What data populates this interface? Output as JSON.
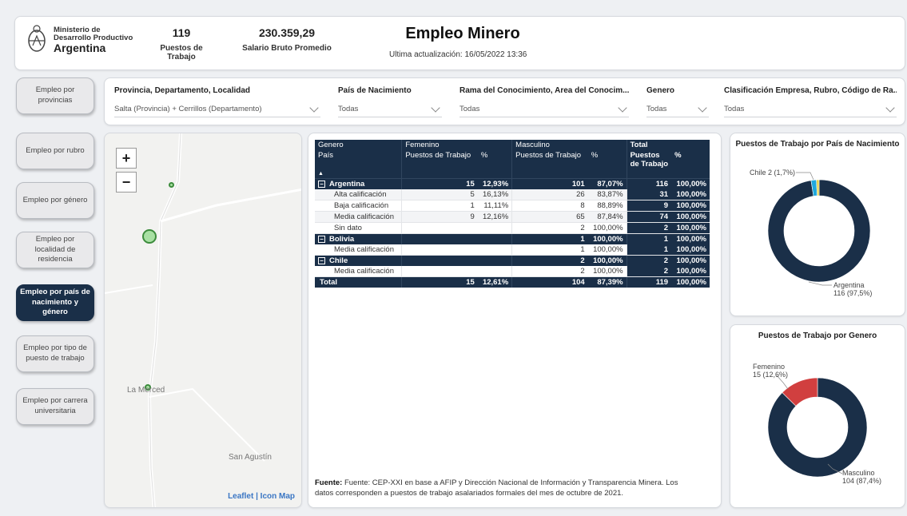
{
  "header": {
    "logo_line1": "Ministerio de",
    "logo_line2": "Desarrollo Productivo",
    "logo_line3": "Argentina",
    "kpi_jobs_value": "119",
    "kpi_jobs_label": "Puestos de Trabajo",
    "kpi_salary_value": "230.359,29",
    "kpi_salary_label": "Salario Bruto Promedio",
    "title": "Empleo Minero",
    "updated": "Ultima actualización: 16/05/2022 13:36"
  },
  "nav": [
    {
      "label": "Empleo por provincias",
      "active": false
    },
    {
      "label": "Empleo por rubro",
      "active": false
    },
    {
      "label": "Empleo por género",
      "active": false
    },
    {
      "label": "Empleo por localidad de residencia",
      "active": false
    },
    {
      "label": "Empleo por país de nacimiento y género",
      "active": true
    },
    {
      "label": "Empleo por tipo de puesto de trabajo",
      "active": false
    },
    {
      "label": "Empleo por carrera universitaria",
      "active": false
    }
  ],
  "filters": [
    {
      "label": "Provincia, Departamento, Localidad",
      "value": "Salta (Provincia) + Cerrillos (Departamento)"
    },
    {
      "label": "País de Nacimiento",
      "value": "Todas"
    },
    {
      "label": "Rama del Conocimiento, Area del Conocim...",
      "value": "Todas"
    },
    {
      "label": "Genero",
      "value": "Todas"
    },
    {
      "label": "Clasificación Empresa, Rubro, Código de Ra...",
      "value": "Todas"
    }
  ],
  "map": {
    "zoom_in": "+",
    "zoom_out": "−",
    "place1": "La Merced",
    "place2": "San Agustín",
    "attribution": "Leaflet | Icon Map"
  },
  "table": {
    "h_genero": "Genero",
    "h_femenino": "Femenino",
    "h_masculino": "Masculino",
    "h_total": "Total",
    "h_pais": "País",
    "h_puestos": "Puestos de Trabajo",
    "h_pct": "%",
    "h_total_puestos": "Puestos de Trabajo",
    "sort_marker": "▲",
    "expander": "−",
    "rows": [
      {
        "type": "grp",
        "name": "Argentina",
        "f_n": "15",
        "f_p": "12,93%",
        "m_n": "101",
        "m_p": "87,07%",
        "t_n": "116",
        "t_p": "100,00%"
      },
      {
        "type": "sub",
        "name": "Alta calificación",
        "f_n": "5",
        "f_p": "16,13%",
        "m_n": "26",
        "m_p": "83,87%",
        "t_n": "31",
        "t_p": "100,00%"
      },
      {
        "type": "sub",
        "name": "Baja calificación",
        "f_n": "1",
        "f_p": "11,11%",
        "m_n": "8",
        "m_p": "88,89%",
        "t_n": "9",
        "t_p": "100,00%"
      },
      {
        "type": "sub",
        "name": "Media calificación",
        "f_n": "9",
        "f_p": "12,16%",
        "m_n": "65",
        "m_p": "87,84%",
        "t_n": "74",
        "t_p": "100,00%"
      },
      {
        "type": "sub",
        "name": "Sin dato",
        "f_n": "",
        "f_p": "",
        "m_n": "2",
        "m_p": "100,00%",
        "t_n": "2",
        "t_p": "100,00%"
      },
      {
        "type": "grp",
        "name": "Bolivia",
        "f_n": "",
        "f_p": "",
        "m_n": "1",
        "m_p": "100,00%",
        "t_n": "1",
        "t_p": "100,00%"
      },
      {
        "type": "sub",
        "name": "Media calificación",
        "f_n": "",
        "f_p": "",
        "m_n": "1",
        "m_p": "100,00%",
        "t_n": "1",
        "t_p": "100,00%"
      },
      {
        "type": "grp",
        "name": "Chile",
        "f_n": "",
        "f_p": "",
        "m_n": "2",
        "m_p": "100,00%",
        "t_n": "2",
        "t_p": "100,00%"
      },
      {
        "type": "sub",
        "name": "Media calificación",
        "f_n": "",
        "f_p": "",
        "m_n": "2",
        "m_p": "100,00%",
        "t_n": "2",
        "t_p": "100,00%"
      },
      {
        "type": "total",
        "name": "Total",
        "f_n": "15",
        "f_p": "12,61%",
        "m_n": "104",
        "m_p": "87,39%",
        "t_n": "119",
        "t_p": "100,00%"
      }
    ],
    "footnote_bold": "Fuente:",
    "footnote_text": "Fuente: CEP-XXI en base a AFIP y Dirección Nacional de Información y Transparencia Minera. Los datos corresponden a puestos de trabajo asalariados formales del mes de octubre de 2021."
  },
  "colors": {
    "navy": "#1a2f48",
    "red": "#d13f3f",
    "cyan": "#22a9dd",
    "yellow": "#e8d24a"
  },
  "chart_data": [
    {
      "type": "pie",
      "title": "Puestos de Trabajo por País de Nacimiento",
      "slices": [
        {
          "name": "Argentina",
          "value": 116,
          "label": "Argentina\n116 (97,5%)",
          "color": "#1a2f48"
        },
        {
          "name": "Chile",
          "value": 2,
          "label": "Chile 2 (1,7%)",
          "color": "#22a9dd"
        },
        {
          "name": "Bolivia",
          "value": 1,
          "label": "",
          "color": "#e8d24a"
        }
      ]
    },
    {
      "type": "pie",
      "title": "Puestos de Trabajo por Genero",
      "slices": [
        {
          "name": "Masculino",
          "value": 104,
          "label": "Masculino\n104 (87,4%)",
          "color": "#1a2f48"
        },
        {
          "name": "Femenino",
          "value": 15,
          "label": "Femenino\n15 (12,6%)",
          "color": "#d13f3f"
        }
      ]
    }
  ]
}
